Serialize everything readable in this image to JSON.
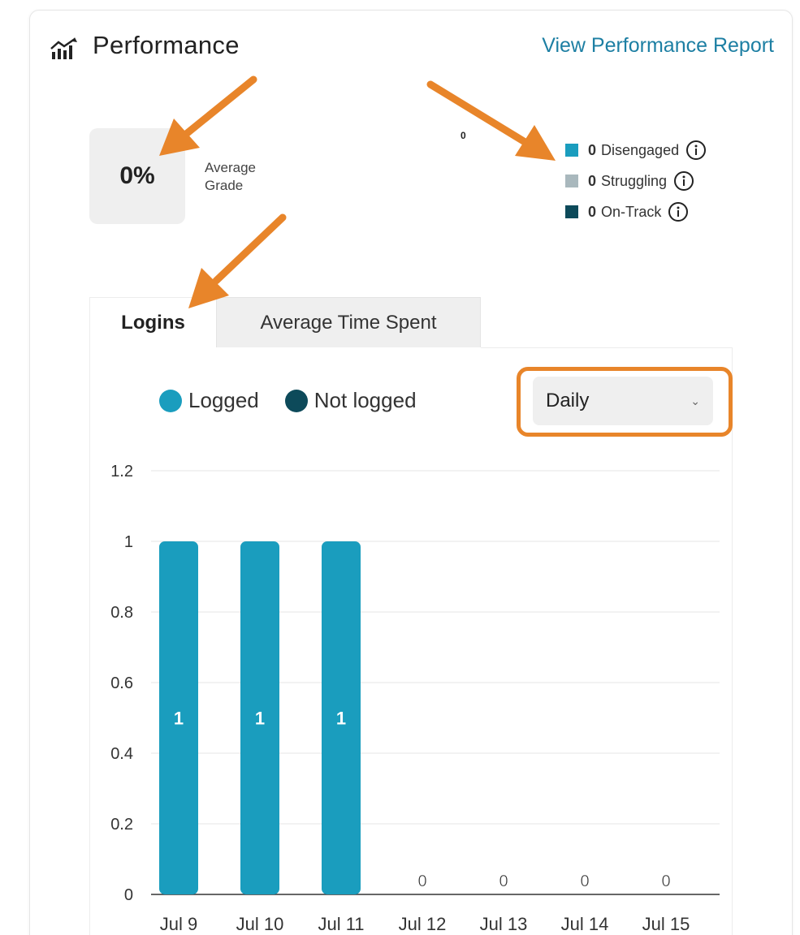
{
  "header": {
    "title": "Performance",
    "icon": "line-chart-icon",
    "report_link": "View Performance Report"
  },
  "grade": {
    "value": "0%",
    "label": "Average Grade"
  },
  "donut": {
    "center_value": "0"
  },
  "status_legend": [
    {
      "count": "0",
      "label": "Disengaged",
      "color": "#1a9dbe",
      "icon": "info-icon"
    },
    {
      "count": "0",
      "label": "Struggling",
      "color": "#a9b8bd",
      "icon": "info-icon"
    },
    {
      "count": "0",
      "label": "On-Track",
      "color": "#0d4a5a",
      "icon": "info-icon"
    }
  ],
  "tabs": [
    {
      "label": "Logins",
      "active": true
    },
    {
      "label": "Average Time Spent",
      "active": false
    }
  ],
  "chart_legend": [
    {
      "label": "Logged",
      "color": "#1a9dbe"
    },
    {
      "label": "Not logged",
      "color": "#0d4a5a"
    }
  ],
  "period_select": {
    "value": "Daily"
  },
  "colors": {
    "accent": "#1a9dbe",
    "link": "#1d7fa3",
    "annotation": "#e8852a"
  },
  "chart_data": {
    "type": "bar",
    "categories": [
      "Jul 9",
      "Jul 10",
      "Jul 11",
      "Jul 12",
      "Jul 13",
      "Jul 14",
      "Jul 15"
    ],
    "series": [
      {
        "name": "Logged",
        "values": [
          1,
          1,
          1,
          0,
          0,
          0,
          0
        ]
      }
    ],
    "data_labels": [
      "1",
      "1",
      "1",
      "0",
      "0",
      "0",
      "0"
    ],
    "yticks": [
      "0",
      "0.2",
      "0.4",
      "0.6",
      "0.8",
      "1",
      "1.2"
    ],
    "ylim": [
      0,
      1.2
    ],
    "grid": true
  }
}
